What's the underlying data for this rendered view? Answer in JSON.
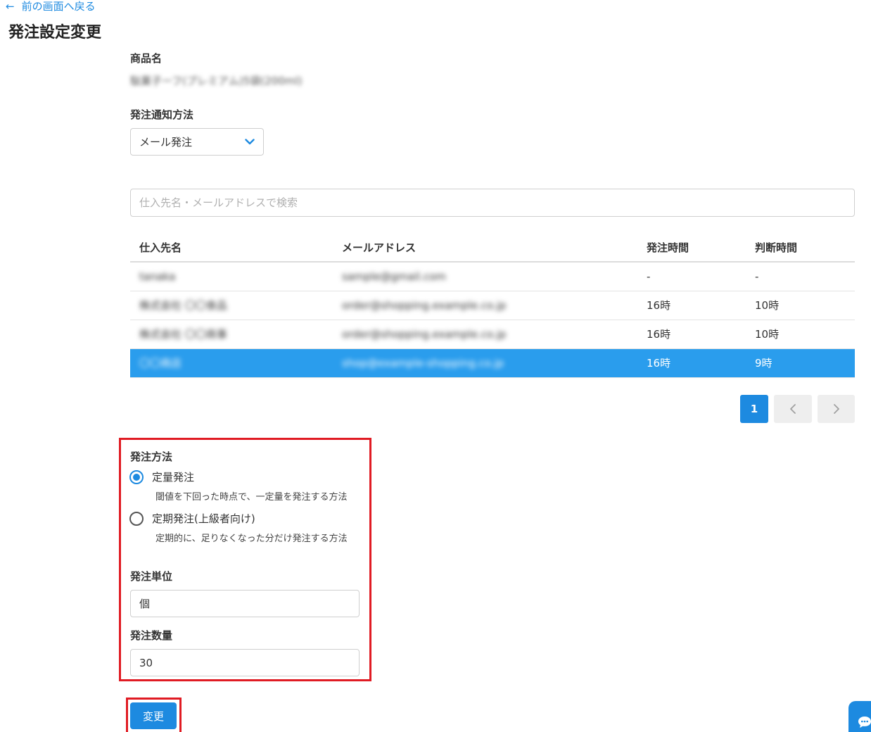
{
  "nav": {
    "back_arrow": "←",
    "back_label": "前の画面へ戻る"
  },
  "page_title": "発注設定変更",
  "product": {
    "label": "商品名",
    "value": "駄菓子ーフ(プレミアム)5袋(200ml)"
  },
  "notification": {
    "label": "発注通知方法",
    "selected": "メール発注"
  },
  "search": {
    "placeholder": "仕入先名・メールアドレスで検索",
    "value": ""
  },
  "table": {
    "headers": [
      "仕入先名",
      "メールアドレス",
      "発注時間",
      "判断時間"
    ],
    "rows": [
      {
        "name": "tanaka",
        "email": "sample@gmail.com",
        "order_time": "-",
        "judge_time": "-",
        "selected": false
      },
      {
        "name": "株式会社 〇〇食品",
        "email": "order@shopping.example.co.jp",
        "order_time": "16時",
        "judge_time": "10時",
        "selected": false
      },
      {
        "name": "株式会社 〇〇商事",
        "email": "order@shopping.example.co.jp",
        "order_time": "16時",
        "judge_time": "10時",
        "selected": false
      },
      {
        "name": "〇〇商店",
        "email": "shop@example-shopping.co.jp",
        "order_time": "16時",
        "judge_time": "9時",
        "selected": true
      }
    ]
  },
  "pagination": {
    "current": "1",
    "prev_icon": "‹",
    "next_icon": "›"
  },
  "order_method": {
    "label": "発注方法",
    "options": [
      {
        "label": "定量発注",
        "desc": "閾値を下回った時点で、一定量を発注する方法",
        "checked": true
      },
      {
        "label": "定期発注(上級者向け)",
        "desc": "定期的に、足りなくなった分だけ発注する方法",
        "checked": false
      }
    ]
  },
  "order_unit": {
    "label": "発注単位",
    "value": "個"
  },
  "order_qty": {
    "label": "発注数量",
    "value": "30"
  },
  "submit_label": "変更",
  "colors": {
    "accent": "#1d8ae0",
    "selected_row": "#2a9ded",
    "highlight_border": "#e01b23"
  },
  "icons": {
    "back": "arrow-left-icon",
    "select": "chevron-down-icon",
    "prev": "chevron-left-icon",
    "next": "chevron-right-icon",
    "chat": "chat-bubble-icon"
  }
}
